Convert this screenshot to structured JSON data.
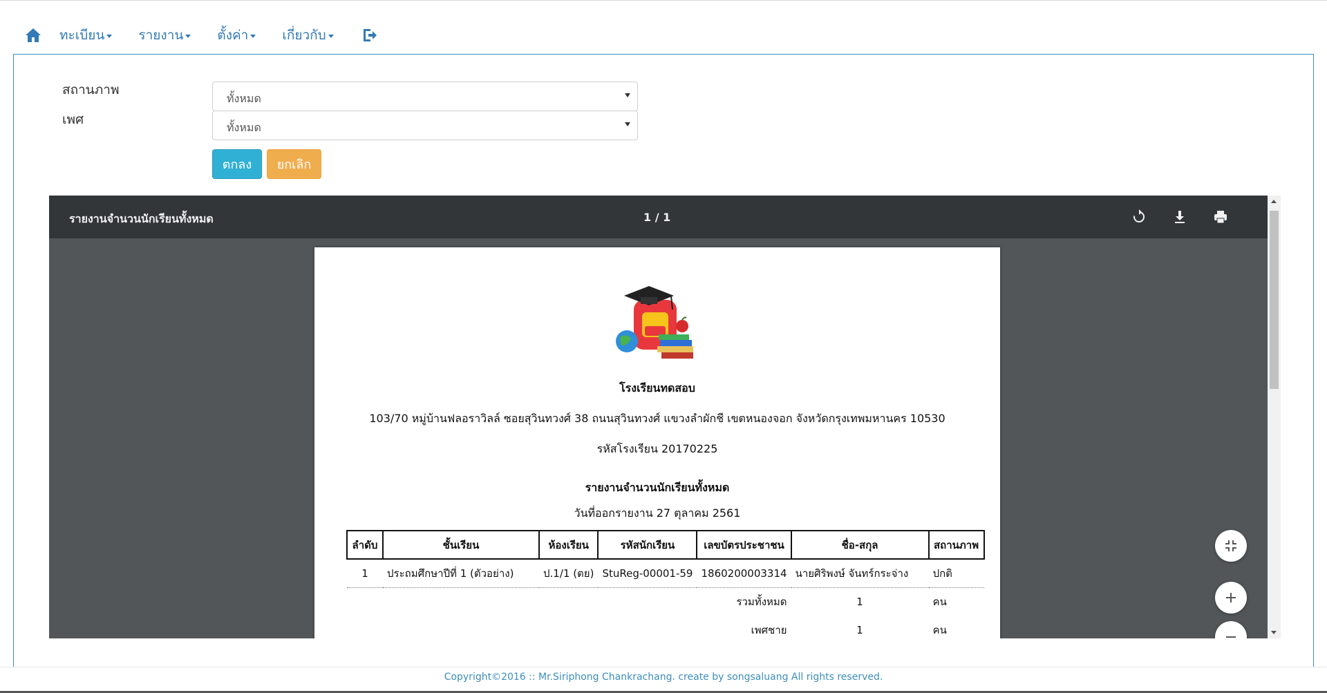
{
  "nav": {
    "items": [
      {
        "label": "ทะเบียน"
      },
      {
        "label": "รายงาน"
      },
      {
        "label": "ตั้งค่า"
      },
      {
        "label": "เกี่ยวกับ"
      }
    ]
  },
  "form": {
    "status_label": "สถานภาพ",
    "status_value": "ทั้งหมด",
    "gender_label": "เพศ",
    "gender_value": "ทั้งหมด",
    "ok_label": "ตกลง",
    "cancel_label": "ยกเลิก"
  },
  "viewer": {
    "title": "รายงานจำนวนนักเรียนทั้งหมด",
    "page_indicator": "1 / 1"
  },
  "document": {
    "school_name": "โรงเรียนทดสอบ",
    "address": "103/70 หมู่บ้านฟลอราวิลล์ ซอยสุวินทวงศ์ 38 ถนนสุวินทวงศ์ แขวงลำผักชี เขตหนองจอก จังหวัดกรุงเทพมหานคร 10530",
    "school_code": "รหัสโรงเรียน 20170225",
    "report_title": "รายงานจำนวนนักเรียนทั้งหมด",
    "report_date": "วันที่ออกรายงาน 27 ตุลาคม 2561",
    "table": {
      "headers": [
        "ลำดับ",
        "ชั้นเรียน",
        "ห้องเรียน",
        "รหัสนักเรียน",
        "เลขบัตรประชาชน",
        "ชื่อ-สกุล",
        "สถานภาพ"
      ],
      "rows": [
        [
          "1",
          "ประถมศึกษาปีที่ 1 (ตัวอย่าง)",
          "ป.1/1 (ตย)",
          "StuReg-00001-59",
          "1860200003314",
          "นายศิริพงษ์ จันทร์กระจ่าง",
          "ปกติ"
        ]
      ],
      "summary": [
        {
          "label": "รวมทั้งหมด",
          "value": "1",
          "unit": "คน"
        },
        {
          "label": "เพศชาย",
          "value": "1",
          "unit": "คน"
        }
      ]
    }
  },
  "footer": {
    "text": "Copyright©2016 :: Mr.Siriphong Chankrachang. create by songsaluang All rights reserved."
  },
  "colors": {
    "nav_link": "#337ab7",
    "panel_border": "#3c8dbc",
    "ok_button": "#31b0d5",
    "cancel_button": "#f0ad4e",
    "viewer_toolbar": "#323639",
    "viewer_background": "#525659"
  },
  "icons": {
    "home": "home-icon",
    "logout": "logout-icon",
    "rotate": "rotate-icon",
    "download": "download-icon",
    "print": "print-icon",
    "fit": "fit-to-page-icon",
    "zoom_in": "zoom-in-icon",
    "zoom_out": "zoom-out-icon"
  }
}
